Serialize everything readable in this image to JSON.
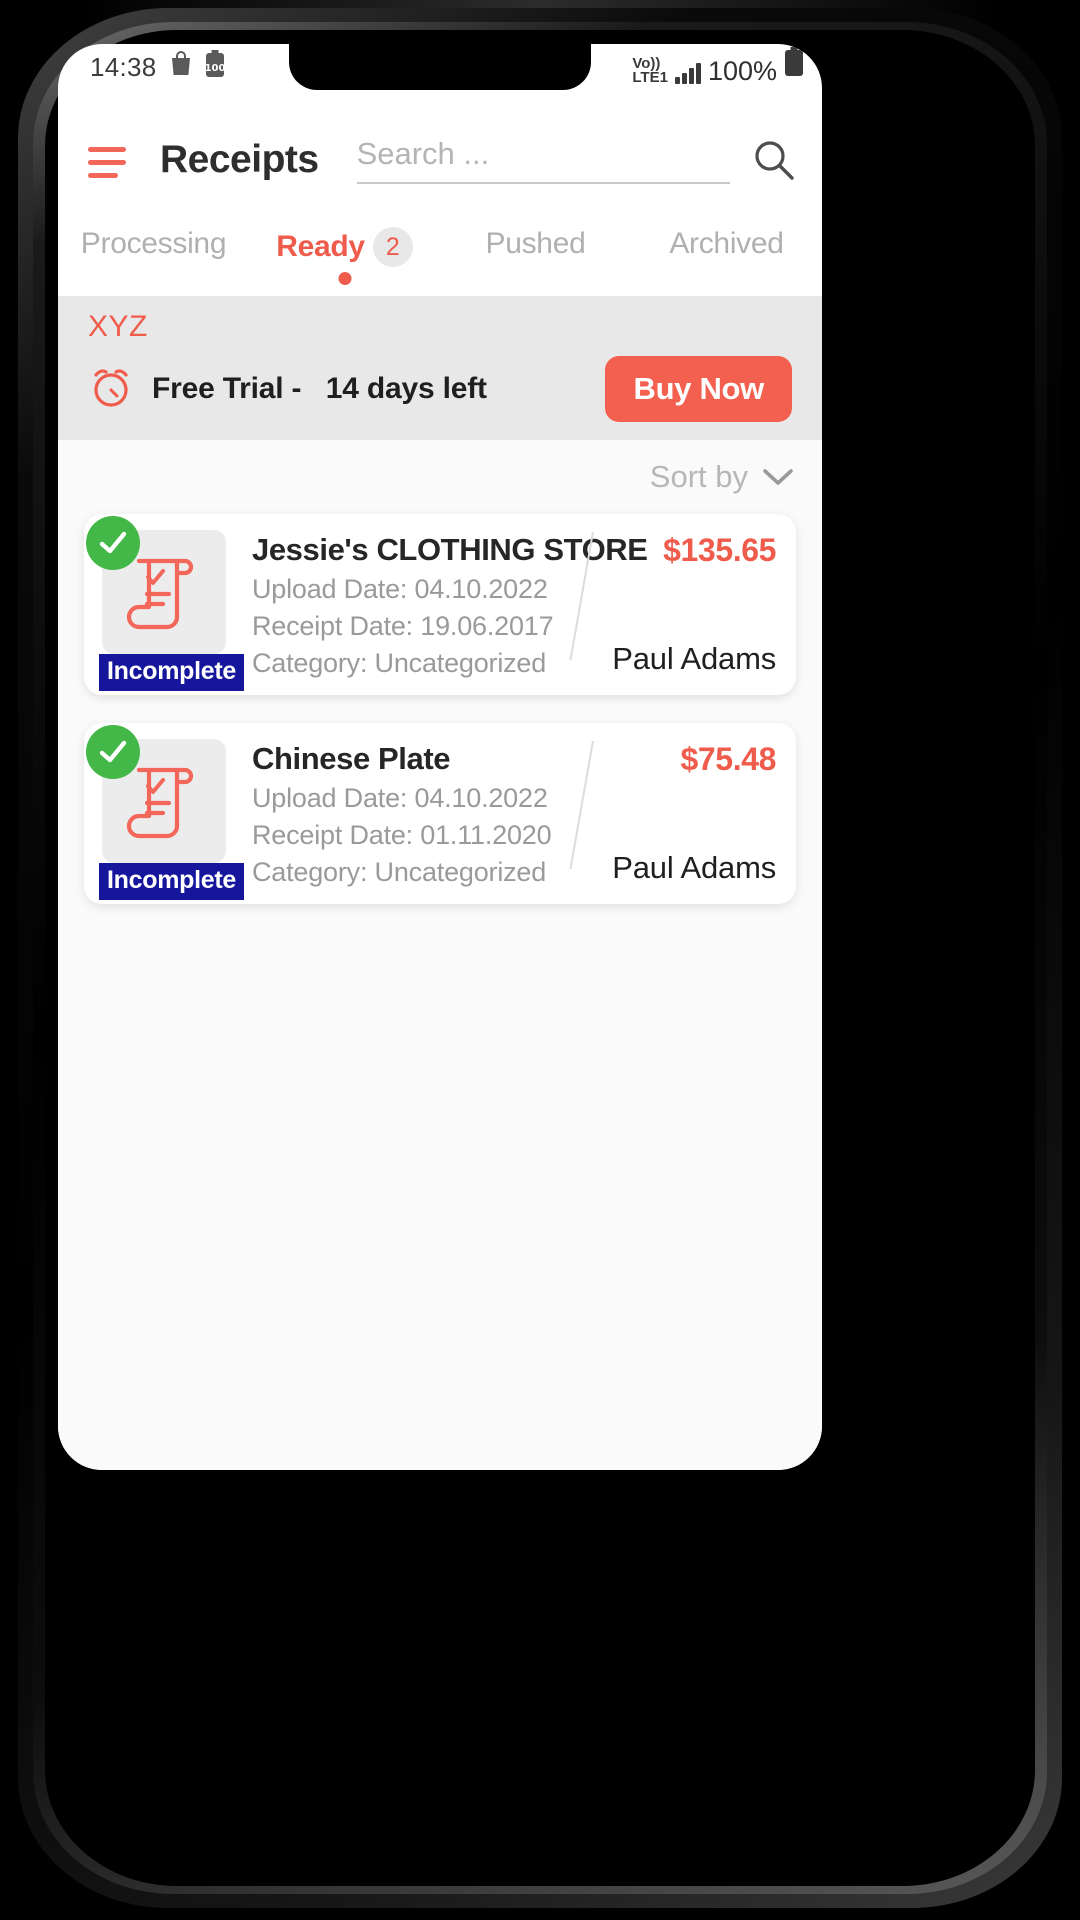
{
  "status_bar": {
    "time": "14:38",
    "icons_left": [
      "shopping-bag-icon",
      "battery-saver-icon"
    ],
    "battery_small_label": "100",
    "network_line1": "Vo))",
    "network_line2": "LTE1",
    "signal_icon": "signal-bars-icon",
    "battery_percent": "100%",
    "battery_icon": "battery-full-icon"
  },
  "header": {
    "menu_icon": "hamburger-menu-icon",
    "title": "Receipts",
    "search_placeholder": "Search ...",
    "search_value": "",
    "search_icon": "search-icon"
  },
  "tabs": [
    {
      "label": "Processing",
      "badge": "",
      "active": false
    },
    {
      "label": "Ready",
      "badge": "2",
      "active": true
    },
    {
      "label": "Pushed",
      "badge": "",
      "active": false
    },
    {
      "label": "Archived",
      "badge": "",
      "active": false
    }
  ],
  "trial_banner": {
    "org_name": "XYZ",
    "clock_icon": "alarm-clock-icon",
    "trial_label": "Free Trial -",
    "trial_days": "14 days left",
    "buy_button": "Buy Now"
  },
  "sort": {
    "label": "Sort by",
    "chevron_icon": "chevron-down-icon"
  },
  "receipts": [
    {
      "merchant": "Jessie's CLOTHING STORE",
      "upload_date": "Upload Date: 04.10.2022",
      "receipt_date": "Receipt Date: 19.06.2017",
      "category": "Category: Uncategorized",
      "amount": "$135.65",
      "person_first": "Paul",
      "person_last": "Adams",
      "status_badge": "Incomplete",
      "selected": true,
      "thumb_icon": "receipt-scroll-icon"
    },
    {
      "merchant": "Chinese Plate",
      "upload_date": "Upload Date: 04.10.2022",
      "receipt_date": "Receipt Date: 01.11.2020",
      "category": "Category: Uncategorized",
      "amount": "$75.48",
      "person_first": "Paul",
      "person_last": "Adams",
      "status_badge": "Incomplete",
      "selected": true,
      "thumb_icon": "receipt-scroll-icon"
    }
  ],
  "colors": {
    "accent": "#ef5c4c",
    "button": "#f4604f",
    "badge_navy": "#16169c",
    "check_green": "#43b849",
    "banner_bg": "#e8e8e8",
    "content_bg": "#fafafa"
  }
}
